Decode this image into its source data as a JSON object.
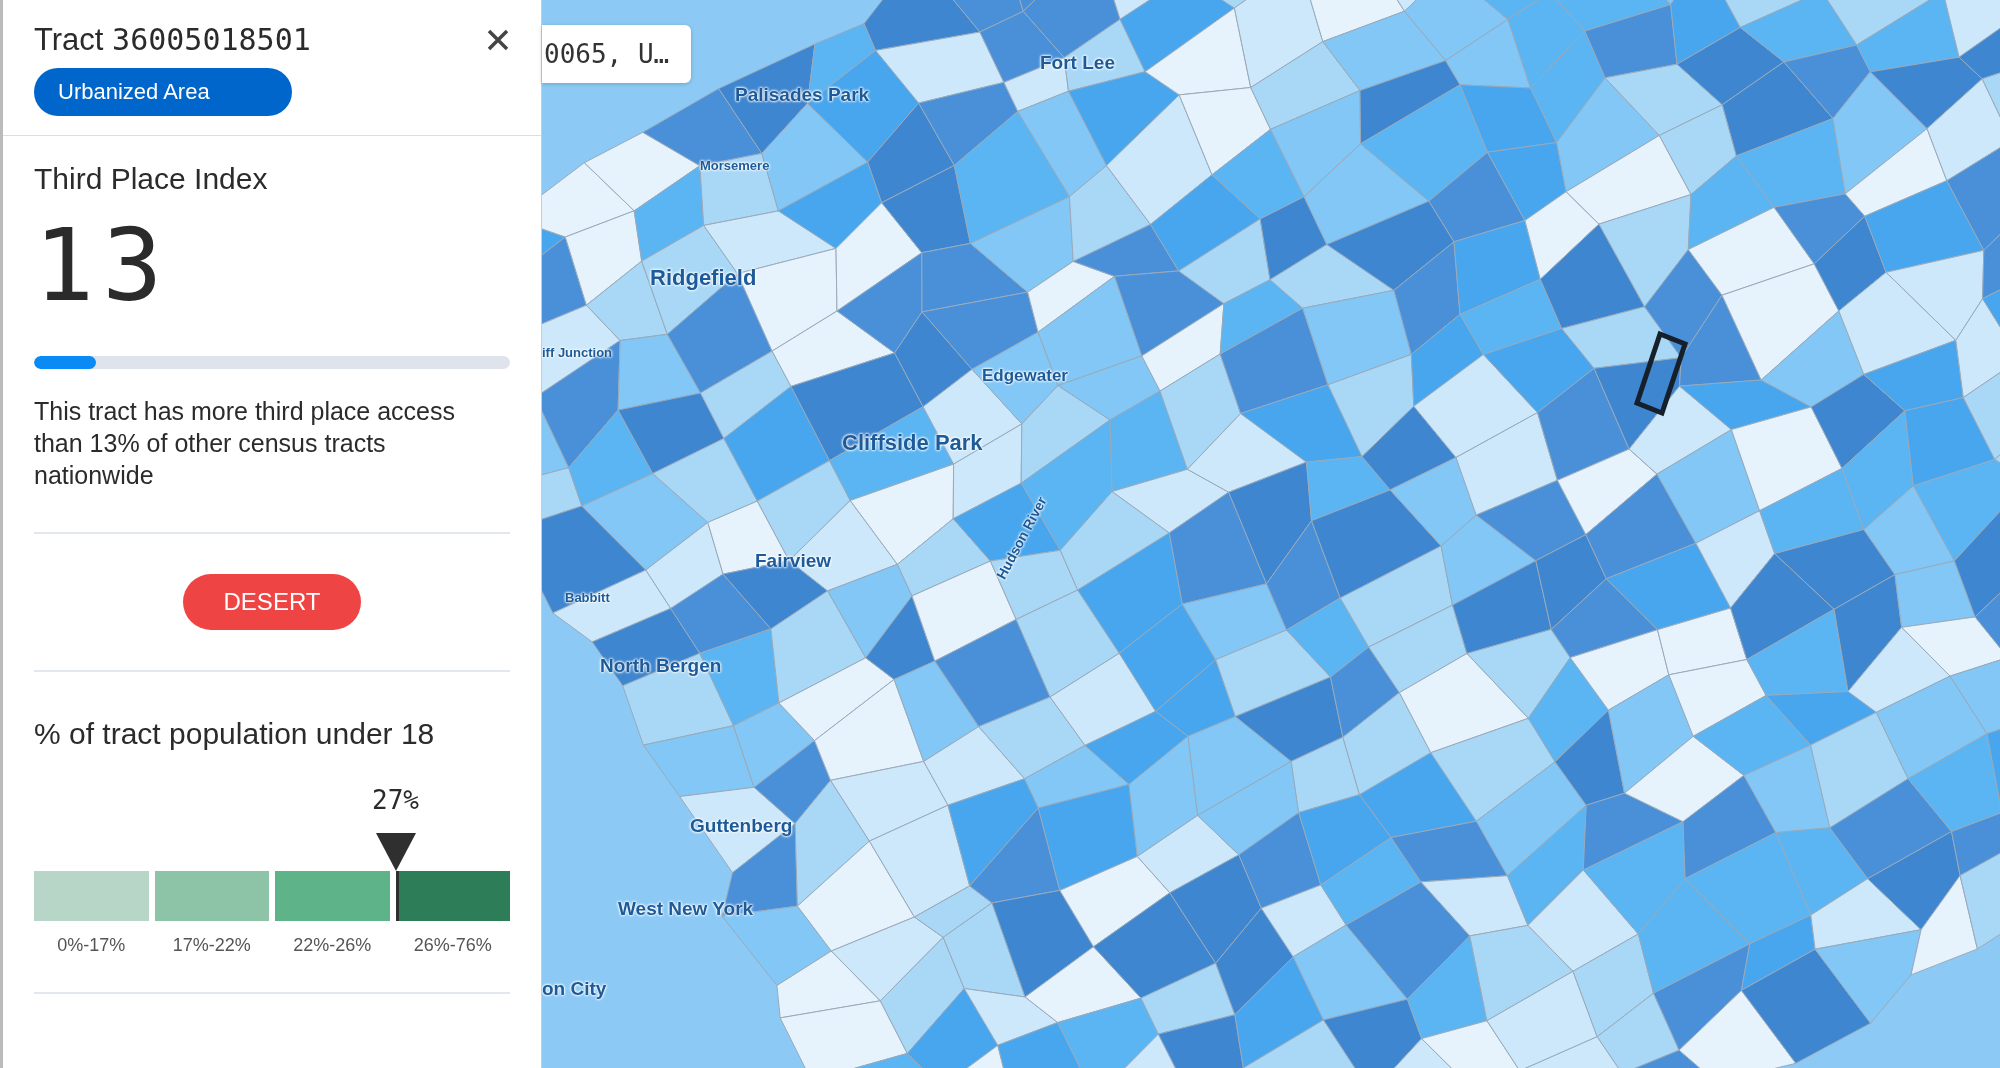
{
  "panel": {
    "title_label": "Tract",
    "tract_id": "36005018501",
    "area_badge": "Urbanized Area",
    "index": {
      "title": "Third Place Index",
      "value": "13",
      "level": 0.13,
      "description": "This tract has more third place access than 13% of other census tracts nationwide"
    },
    "status_badge": {
      "label": "DESERT",
      "kind": "desert"
    },
    "population": {
      "title": "% of tract population under 18",
      "reading": "27%",
      "bins": [
        {
          "label": "0%-17%",
          "color": "#b7d6c8",
          "selected": false
        },
        {
          "label": "17%-22%",
          "color": "#8dc4a7",
          "selected": false
        },
        {
          "label": "22%-26%",
          "color": "#5fb388",
          "selected": false
        },
        {
          "label": "26%-76%",
          "color": "#2e7d59",
          "selected": true
        }
      ]
    }
  },
  "map": {
    "search_value": "0065, U…",
    "places": [
      {
        "name": "Fort Lee"
      },
      {
        "name": "Palisades Park"
      },
      {
        "name": "Morsemere"
      },
      {
        "name": "Ridgefield"
      },
      {
        "name": "iff Junction"
      },
      {
        "name": "Edgewater"
      },
      {
        "name": "Cliffside Park"
      },
      {
        "name": "Fairview"
      },
      {
        "name": "Babbitt"
      },
      {
        "name": "North Bergen"
      },
      {
        "name": "Hudson River"
      },
      {
        "name": "Guttenberg"
      },
      {
        "name": "West New York"
      },
      {
        "name": "on City"
      }
    ]
  }
}
